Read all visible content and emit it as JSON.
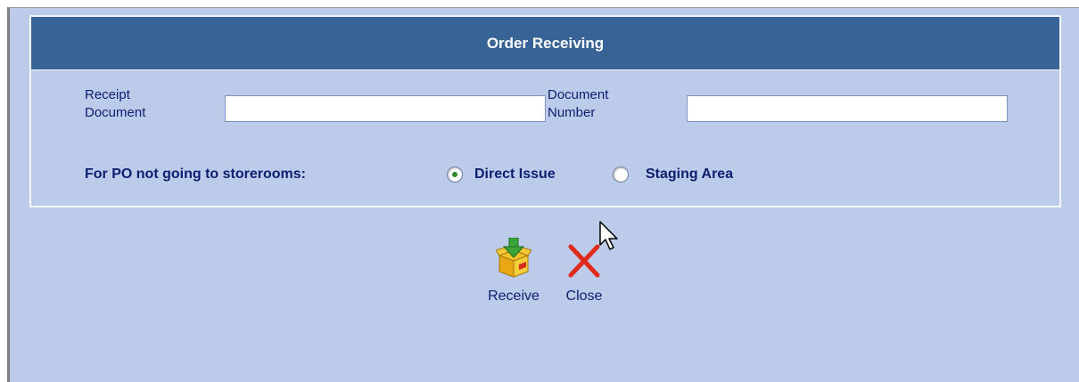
{
  "dialog": {
    "title": "Order Receiving"
  },
  "form": {
    "receipt_document_label": "Receipt\nDocument",
    "receipt_document_value": "",
    "document_number_label": "Document\nNumber",
    "document_number_value": "",
    "po_label": "For PO not going to storerooms:",
    "options": [
      {
        "label": "Direct Issue",
        "selected": true
      },
      {
        "label": "Staging Area",
        "selected": false
      }
    ]
  },
  "actions": {
    "receive_label": "Receive",
    "close_label": "Close",
    "receive_icon": "receive-box-icon",
    "close_icon": "close-x-icon"
  },
  "colors": {
    "header_bg": "#386397",
    "body_bg": "#bccbe9",
    "label_text": "#0c1f6e",
    "radio_selected": "#2e8a2e",
    "close_icon": "#e02a1c"
  }
}
